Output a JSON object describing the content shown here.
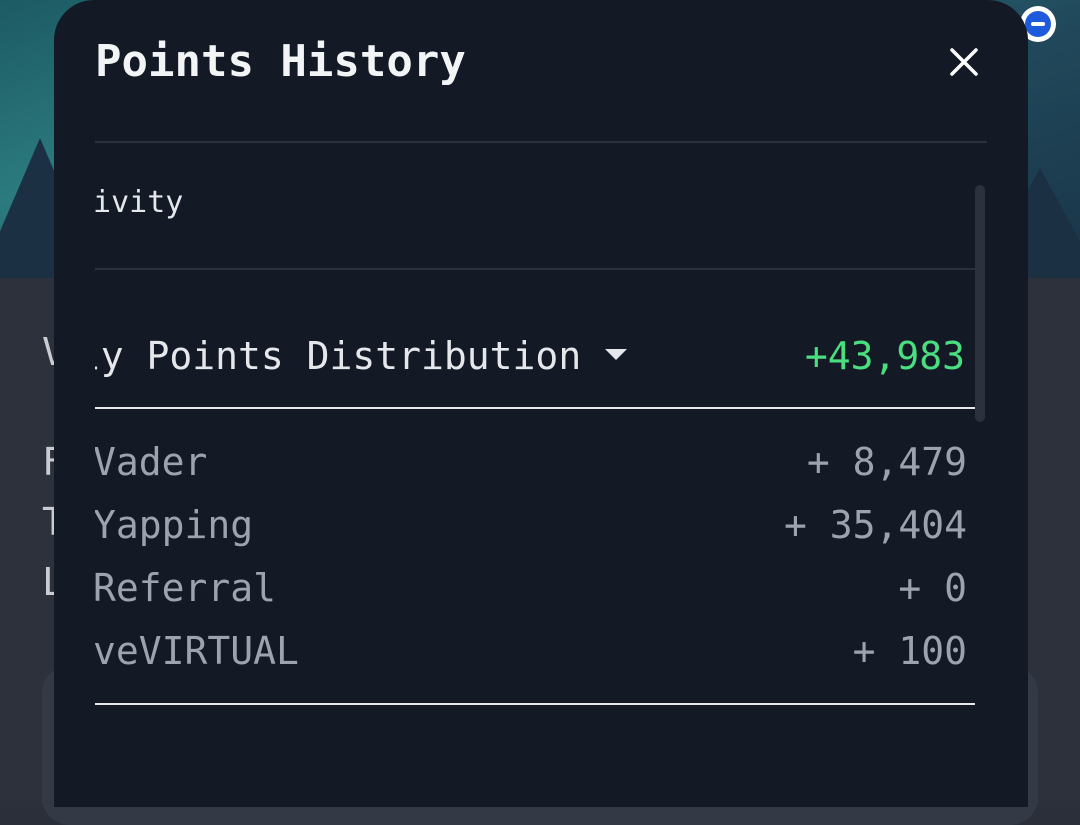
{
  "modal": {
    "title": "Points History",
    "close_icon": "close-icon"
  },
  "activity_tab": {
    "label": "tivity"
  },
  "distribution": {
    "title": "ily Points Distribution",
    "expand_icon": "caret-down-icon",
    "total": "+43,983",
    "total_color": "#4ade80",
    "rows": [
      {
        "label": "Vader",
        "value": "+ 8,479"
      },
      {
        "label": "Yapping",
        "value": "+ 35,404"
      },
      {
        "label": "Referral",
        "value": "+ 0"
      },
      {
        "label": "veVIRTUAL",
        "value": "+ 100"
      }
    ]
  },
  "colors": {
    "modal_bg": "#131a26",
    "accent_green": "#4ade80"
  }
}
